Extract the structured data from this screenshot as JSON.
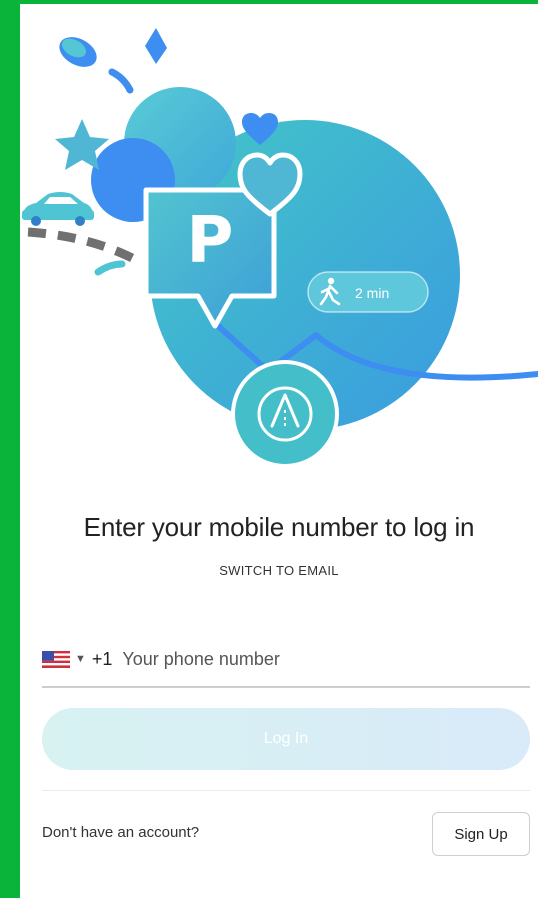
{
  "colors": {
    "accent_green": "#0ab43a",
    "teal": "#4fc4d3",
    "blue": "#3d8ef0",
    "login_gradient_start": "#d7f2f1",
    "login_gradient_end": "#d9eaf9"
  },
  "hero": {
    "parking_letter": "P",
    "walk_time": "2 min",
    "icons": [
      "car-icon",
      "star-icon",
      "heart-icon",
      "walking-person-icon",
      "parking-pin-icon",
      "app-logo-icon"
    ]
  },
  "login": {
    "headline": "Enter your mobile number to log in",
    "switch_label": "SWITCH TO EMAIL",
    "country_flag": "us-flag-icon",
    "dial_code": "+1",
    "phone_placeholder": "Your phone number",
    "phone_value": "",
    "login_button": "Log In"
  },
  "footer": {
    "no_account_text": "Don't have an account?",
    "signup_button": "Sign Up"
  }
}
